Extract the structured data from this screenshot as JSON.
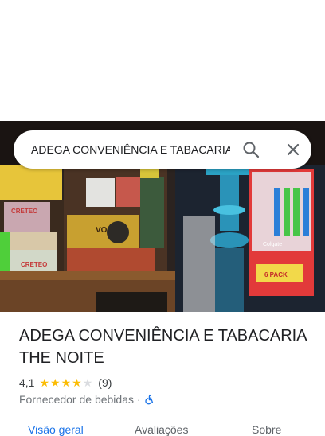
{
  "search": {
    "query": "ADEGA CONVENIÊNCIA E TABACARIA THE NOITE"
  },
  "place": {
    "name": "ADEGA CONVENIÊNCIA E TABACARIA THE NOITE",
    "rating": "4,1",
    "stars_filled": 4,
    "stars_total": 5,
    "review_count": "(9)",
    "category": "Fornecedor de bebidas",
    "separator": "·"
  },
  "tabs": [
    {
      "label": "Visão geral"
    },
    {
      "label": "Avaliações"
    },
    {
      "label": "Sobre"
    }
  ],
  "hero_image_text": {
    "box1": "CRETEO",
    "box2": "CRETEO",
    "box3": "VOCÊ",
    "toothbrush_brand": "Colgate",
    "toothbrush_pack": "6 PACK"
  },
  "icons": {
    "search": "search-icon",
    "close": "close-icon",
    "accessibility": "wheelchair-icon",
    "star": "star-icon"
  },
  "colors": {
    "accent": "#1a73e8",
    "star": "#fbbc04",
    "star_empty": "#dadce0",
    "title": "#202124",
    "secondary": "#70757a"
  }
}
